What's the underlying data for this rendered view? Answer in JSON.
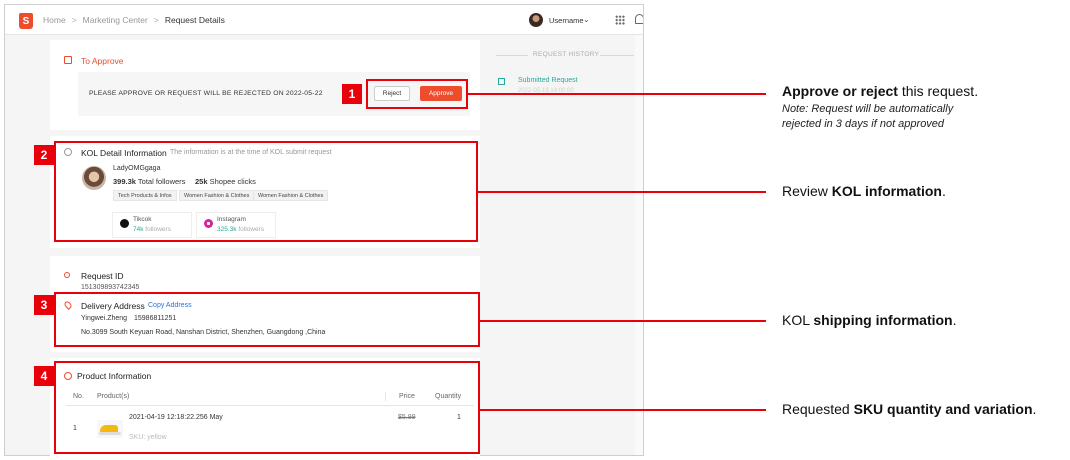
{
  "header": {
    "logo_glyph": "S",
    "breadcrumb": [
      "Home",
      "Marketing Center",
      "Request Details"
    ],
    "username": "Username"
  },
  "approve_section": {
    "title": "To Approve",
    "warning": "PLEASE APPROVE OR REQUEST WILL BE REJECTED ON 2022-05-22",
    "reject_label": "Reject",
    "approve_label": "Approve"
  },
  "kol_section": {
    "title": "KOL Detail Information",
    "subtitle": "The information is at the time of KOL submit request",
    "name": "LadyOMGgaga",
    "total_followers_value": "399.3k",
    "total_followers_label": "Total followers",
    "shopee_clicks_value": "25k",
    "shopee_clicks_label": "Shopee clicks",
    "tags": [
      "Tech Products & Infos",
      "Women Fashion & Clothes",
      "Women Fashion & Clothes"
    ],
    "socials": [
      {
        "platform": "Tikcok",
        "count": "74k",
        "label": "followers",
        "icon": "tiktok-icon"
      },
      {
        "platform": "Instagram",
        "count": "325.3k",
        "label": "followers",
        "icon": "instagram-icon"
      }
    ]
  },
  "request_section": {
    "id_title": "Request ID",
    "id_value": "151309893742345",
    "delivery_title": "Delivery Address",
    "copy_label": "Copy Address",
    "recipient": "Yingwei.Zheng",
    "phone": "15986811251",
    "address": "No.3099 South Keyuan Road, Nanshan District, Shenzhen, Guangdong ,China"
  },
  "product_section": {
    "title": "Product Information",
    "headers": {
      "no": "No.",
      "products": "Product(s)",
      "price": "Price",
      "quantity": "Quantity"
    },
    "rows": [
      {
        "no": "1",
        "name": "2021-04-19 12:18:22.256 May",
        "variation": "SKU: yellow",
        "price": "$5.99",
        "quantity": "1"
      }
    ]
  },
  "history": {
    "title": "REQUEST HISTORY",
    "item_label": "Submitted Request",
    "item_sub": "2022-05-19 14:00:00"
  },
  "annotations": [
    {
      "num": "1",
      "bold": "Approve or reject",
      "rest": " this request.",
      "note": [
        "Note: Request will be automatically",
        "rejected in 3 days if not approved"
      ]
    },
    {
      "num": "2",
      "pre": "Review ",
      "bold": "KOL information",
      "rest": "."
    },
    {
      "num": "3",
      "pre": "KOL ",
      "bold": "shipping information",
      "rest": "."
    },
    {
      "num": "4",
      "pre": "Requested ",
      "bold": "SKU quantity and variation",
      "rest": "."
    }
  ],
  "colors": {
    "brand": "#ee4d2d",
    "annotation": "#e8000b",
    "teal": "#26aa99",
    "link": "#2673dd"
  }
}
